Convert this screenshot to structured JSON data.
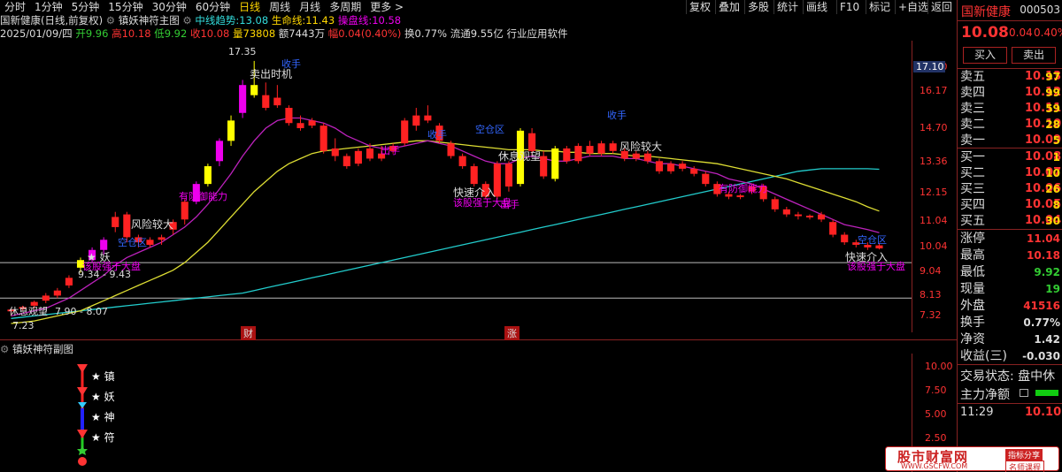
{
  "toolbar": {
    "timeframes": [
      "分时",
      "1分钟",
      "5分钟",
      "15分钟",
      "30分钟",
      "60分钟",
      "日线",
      "周线",
      "月线",
      "多周期",
      "更多 >"
    ],
    "active_index": 6,
    "buttons": [
      "复权",
      "叠加",
      "多股",
      "统计",
      "画线",
      "F10",
      "标记",
      "+自选",
      "返回"
    ]
  },
  "header": {
    "title": "国新健康(日线,前复权)",
    "indicator_name": "镇妖神符主图",
    "mid_label": "中线趋势:",
    "mid_value": "13.08",
    "life_label": "生命线:",
    "life_value": "11.43",
    "op_label": "操盘线:",
    "op_value": "10.58"
  },
  "quote_line": {
    "date": "2025/01/09/四",
    "open_label": "开",
    "open": "9.96",
    "high_label": "高",
    "high": "10.18",
    "low_label": "低",
    "low": "9.92",
    "close_label": "收",
    "close": "10.08",
    "vol_label": "量",
    "vol": "73808",
    "amt_label": "额",
    "amt": "7443万",
    "chg_label": "幅",
    "chg": "0.04(0.40%)",
    "turnover_label": "换",
    "turnover": "0.77%",
    "float_label": "流通",
    "float": "9.55亿",
    "industry": "行业应用软件"
  },
  "price_axis": [
    "17.10",
    "16.17",
    "14.70",
    "13.36",
    "12.15",
    "11.04",
    "10.04",
    "9.04",
    "8.13",
    "7.32"
  ],
  "price_badge": "17.10",
  "sub_axis": [
    "10.00",
    "7.50",
    "5.00",
    "2.50"
  ],
  "sub_title": "镇妖神符副图",
  "sub_stars": [
    "★ 镇",
    "★ 妖",
    "★ 神",
    "★ 符"
  ],
  "annotations": {
    "high_mark": "17.35",
    "sell_time": "卖出时机",
    "collect": "收手",
    "risk1": "风险较大",
    "risk2": "风险较大",
    "anti": "有防御能力",
    "anti2": "有防御能力",
    "empty1": "空仓区",
    "empty2": "空仓区",
    "empty3": "空仓区",
    "demon": "★ 妖",
    "range1": "9.34 - 9.43",
    "strong1": "该股强于大盘",
    "rest": "休息观望",
    "range2": "7.90 - 8.07",
    "low_mark": "7.23",
    "chushou": "出手",
    "shoushou": "收手",
    "fast1": "快速介入",
    "strong2": "该股强于大盘",
    "rest2": "休息观望",
    "fast2": "快速介入",
    "strong3": "该股强于大盘",
    "collect2": "收手",
    "chushou2": "出手",
    "finance": "财",
    "rise": "涨"
  },
  "right": {
    "name": "国新健康",
    "code": "000503",
    "price": "10.08",
    "change": "0.04",
    "pct": "0.40%",
    "buy_btn": "买入",
    "sell_btn": "卖出",
    "asks": [
      {
        "label": "卖五",
        "price": "10.13",
        "vol": "97"
      },
      {
        "label": "卖四",
        "price": "10.12",
        "vol": "99"
      },
      {
        "label": "卖三",
        "price": "10.11",
        "vol": "59"
      },
      {
        "label": "卖二",
        "price": "10.10",
        "vol": "28"
      },
      {
        "label": "卖一",
        "price": "10.09",
        "vol": "5"
      }
    ],
    "bids": [
      {
        "label": "买一",
        "price": "10.08",
        "vol": "1"
      },
      {
        "label": "买二",
        "price": "10.07",
        "vol": "10"
      },
      {
        "label": "买三",
        "price": "10.06",
        "vol": "26"
      },
      {
        "label": "买四",
        "price": "10.05",
        "vol": "8"
      },
      {
        "label": "买五",
        "price": "10.04",
        "vol": "30"
      }
    ],
    "stats": [
      {
        "label": "涨停",
        "val": "11.04",
        "color": "#f33"
      },
      {
        "label": "最高",
        "val": "10.18",
        "color": "#f33"
      },
      {
        "label": "最低",
        "val": "9.92",
        "color": "#3c3"
      },
      {
        "label": "现量",
        "val": "19",
        "color": "#3c3"
      },
      {
        "label": "外盘",
        "val": "41516",
        "color": "#f33"
      },
      {
        "label": "换手",
        "val": "0.77%",
        "color": "#ddd"
      },
      {
        "label": "净资",
        "val": "1.42",
        "color": "#ddd"
      },
      {
        "label": "收益(三)",
        "val": "-0.030",
        "color": "#ddd"
      }
    ],
    "trade_status": "交易状态: 盘中休",
    "main_flow": "主力净额",
    "time": "11:29",
    "last_price": "10.10"
  },
  "watermark": {
    "main": "股市财富网",
    "url": "WWW.GSCFW.COM",
    "tag1": "指标分享",
    "tag2": "名师课程"
  },
  "chart_data": {
    "type": "candlestick",
    "ylim": [
      7.0,
      17.8
    ],
    "candles": [
      [
        7.5,
        7.6,
        7.3,
        7.55
      ],
      [
        7.6,
        7.7,
        7.5,
        7.65
      ],
      [
        7.7,
        7.9,
        7.6,
        7.85
      ],
      [
        7.9,
        8.2,
        7.8,
        8.1
      ],
      [
        8.1,
        8.4,
        8.0,
        8.3
      ],
      [
        8.5,
        8.9,
        8.4,
        8.8
      ],
      [
        9.2,
        9.6,
        9.0,
        9.5
      ],
      [
        9.5,
        10.0,
        9.4,
        9.9
      ],
      [
        9.9,
        10.4,
        9.7,
        10.3
      ],
      [
        10.8,
        11.4,
        10.6,
        11.2
      ],
      [
        11.3,
        11.4,
        10.2,
        10.4
      ],
      [
        10.4,
        10.5,
        10.0,
        10.2
      ],
      [
        10.1,
        10.4,
        10.0,
        10.3
      ],
      [
        10.3,
        10.5,
        10.1,
        10.4
      ],
      [
        10.7,
        11.1,
        10.5,
        11.0
      ],
      [
        11.1,
        11.9,
        10.9,
        11.8
      ],
      [
        11.8,
        12.6,
        11.7,
        12.5
      ],
      [
        12.5,
        13.3,
        12.4,
        13.2
      ],
      [
        13.4,
        14.3,
        13.2,
        14.2
      ],
      [
        14.2,
        15.2,
        14.0,
        15.0
      ],
      [
        15.3,
        16.6,
        15.1,
        16.4
      ],
      [
        16.4,
        17.35,
        15.9,
        16.0
      ],
      [
        16.0,
        16.5,
        15.4,
        15.5
      ],
      [
        15.6,
        16.4,
        15.5,
        15.9
      ],
      [
        15.5,
        15.6,
        14.8,
        14.9
      ],
      [
        14.9,
        15.2,
        14.6,
        14.7
      ],
      [
        14.8,
        15.1,
        14.7,
        15.0
      ],
      [
        14.8,
        14.9,
        13.7,
        13.8
      ],
      [
        13.9,
        14.3,
        13.4,
        13.6
      ],
      [
        13.6,
        13.7,
        13.1,
        13.2
      ],
      [
        13.3,
        13.9,
        13.2,
        13.8
      ],
      [
        13.9,
        14.1,
        13.4,
        13.5
      ],
      [
        13.5,
        14.0,
        13.4,
        13.7
      ],
      [
        13.8,
        14.1,
        13.7,
        14.0
      ],
      [
        14.1,
        15.1,
        14.0,
        15.0
      ],
      [
        14.8,
        15.5,
        14.6,
        15.2
      ],
      [
        15.2,
        15.6,
        14.9,
        15.0
      ],
      [
        14.8,
        14.9,
        14.1,
        14.2
      ],
      [
        14.1,
        14.2,
        13.5,
        13.6
      ],
      [
        13.6,
        13.7,
        13.1,
        13.2
      ],
      [
        13.2,
        13.3,
        12.4,
        12.5
      ],
      [
        12.5,
        12.6,
        11.9,
        12.0
      ],
      [
        12.0,
        13.4,
        11.9,
        13.3
      ],
      [
        13.3,
        13.4,
        12.2,
        12.4
      ],
      [
        12.5,
        14.7,
        12.4,
        14.6
      ],
      [
        14.5,
        14.7,
        13.6,
        13.8
      ],
      [
        13.6,
        13.8,
        12.7,
        12.8
      ],
      [
        12.7,
        14.0,
        12.6,
        13.9
      ],
      [
        13.9,
        14.0,
        13.3,
        13.4
      ],
      [
        13.4,
        14.1,
        13.3,
        14.0
      ],
      [
        14.0,
        14.2,
        13.6,
        13.7
      ],
      [
        13.7,
        14.2,
        13.6,
        14.1
      ],
      [
        14.1,
        14.2,
        13.7,
        13.8
      ],
      [
        13.8,
        13.9,
        13.4,
        13.5
      ],
      [
        13.5,
        13.8,
        13.4,
        13.7
      ],
      [
        13.7,
        13.8,
        13.3,
        13.4
      ],
      [
        13.4,
        13.5,
        12.9,
        13.0
      ],
      [
        13.0,
        13.4,
        12.9,
        13.3
      ],
      [
        13.3,
        13.4,
        13.0,
        13.1
      ],
      [
        13.1,
        13.2,
        12.8,
        12.9
      ],
      [
        12.9,
        13.0,
        12.4,
        12.5
      ],
      [
        12.5,
        12.6,
        12.0,
        12.1
      ],
      [
        12.1,
        12.2,
        11.9,
        12.0
      ],
      [
        12.0,
        12.1,
        11.9,
        12.05
      ],
      [
        12.2,
        12.5,
        12.1,
        12.4
      ],
      [
        12.4,
        12.5,
        11.8,
        11.9
      ],
      [
        11.9,
        12.0,
        11.4,
        11.5
      ],
      [
        11.5,
        11.6,
        11.2,
        11.3
      ],
      [
        11.3,
        11.4,
        11.1,
        11.25
      ],
      [
        11.25,
        11.3,
        11.1,
        11.2
      ],
      [
        11.3,
        11.4,
        11.0,
        11.1
      ],
      [
        11.0,
        11.1,
        10.4,
        10.5
      ],
      [
        10.5,
        10.6,
        10.1,
        10.2
      ],
      [
        10.2,
        10.3,
        10.0,
        10.1
      ],
      [
        10.0,
        10.2,
        9.9,
        10.1
      ],
      [
        9.96,
        10.18,
        9.92,
        10.08
      ]
    ],
    "mid_trend": [
      7.2,
      7.25,
      7.3,
      7.35,
      7.4,
      7.45,
      7.5,
      7.55,
      7.6,
      7.65,
      7.7,
      7.75,
      7.8,
      7.85,
      7.9,
      7.95,
      8.0,
      8.05,
      8.1,
      8.15,
      8.2,
      8.3,
      8.4,
      8.5,
      8.6,
      8.7,
      8.8,
      8.9,
      9.0,
      9.1,
      9.2,
      9.3,
      9.4,
      9.5,
      9.6,
      9.7,
      9.8,
      9.9,
      10.0,
      10.1,
      10.2,
      10.3,
      10.4,
      10.5,
      10.6,
      10.7,
      10.8,
      10.9,
      11.0,
      11.1,
      11.2,
      11.3,
      11.4,
      11.5,
      11.6,
      11.7,
      11.8,
      11.9,
      12.0,
      12.1,
      12.2,
      12.3,
      12.4,
      12.5,
      12.6,
      12.7,
      12.8,
      12.9,
      13.0,
      13.05,
      13.1,
      13.1,
      13.1,
      13.1,
      13.1,
      13.08
    ],
    "life_line": [
      7.0,
      7.05,
      7.1,
      7.2,
      7.3,
      7.4,
      7.5,
      7.7,
      7.9,
      8.1,
      8.3,
      8.5,
      8.7,
      8.9,
      9.1,
      9.4,
      9.8,
      10.2,
      10.7,
      11.2,
      11.7,
      12.2,
      12.6,
      13.0,
      13.3,
      13.5,
      13.7,
      13.8,
      13.85,
      13.9,
      13.95,
      14.0,
      14.05,
      14.1,
      14.15,
      14.2,
      14.2,
      14.15,
      14.1,
      14.05,
      14.0,
      13.95,
      13.9,
      13.85,
      13.85,
      13.85,
      13.8,
      13.8,
      13.75,
      13.75,
      13.7,
      13.7,
      13.7,
      13.65,
      13.6,
      13.6,
      13.55,
      13.5,
      13.45,
      13.4,
      13.35,
      13.3,
      13.2,
      13.1,
      13.0,
      12.9,
      12.8,
      12.7,
      12.55,
      12.4,
      12.25,
      12.1,
      11.95,
      11.8,
      11.6,
      11.43
    ],
    "op_line": [
      7.3,
      7.4,
      7.5,
      7.6,
      7.8,
      8.0,
      8.3,
      8.6,
      8.9,
      9.3,
      9.6,
      9.8,
      10.0,
      10.2,
      10.5,
      10.8,
      11.2,
      11.7,
      12.3,
      12.9,
      13.6,
      14.2,
      14.7,
      15.0,
      15.1,
      15.1,
      15.0,
      14.9,
      14.7,
      14.4,
      14.2,
      14.0,
      13.9,
      13.9,
      14.0,
      14.1,
      14.2,
      14.1,
      14.0,
      13.8,
      13.6,
      13.4,
      13.3,
      13.3,
      13.5,
      13.6,
      13.5,
      13.4,
      13.4,
      13.5,
      13.6,
      13.6,
      13.6,
      13.5,
      13.5,
      13.4,
      13.3,
      13.3,
      13.2,
      13.1,
      13.0,
      12.9,
      12.7,
      12.6,
      12.5,
      12.3,
      12.1,
      11.9,
      11.7,
      11.5,
      11.3,
      11.1,
      10.9,
      10.8,
      10.7,
      10.58
    ]
  }
}
